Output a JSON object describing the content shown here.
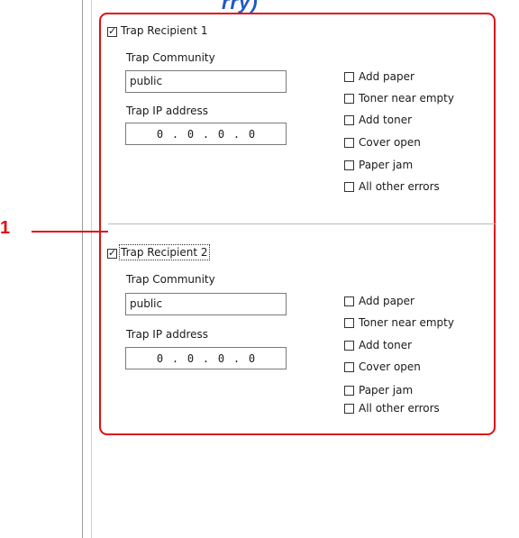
{
  "heading_fragment": "rry)",
  "callout_number": "1",
  "trap_recipients": [
    {
      "label": "Trap Recipient 1",
      "checked": true,
      "community_label": "Trap Community",
      "community_value": "public",
      "ip_label": "Trap IP address",
      "ip_octets": [
        "0",
        "0",
        "0",
        "0"
      ],
      "events": [
        {
          "label": "Add paper",
          "checked": false
        },
        {
          "label": "Toner near empty",
          "checked": false
        },
        {
          "label": "Add toner",
          "checked": false
        },
        {
          "label": "Cover open",
          "checked": false
        },
        {
          "label": "Paper jam",
          "checked": false
        },
        {
          "label": "All other errors",
          "checked": false
        }
      ]
    },
    {
      "label": "Trap Recipient 2",
      "checked": true,
      "community_label": "Trap Community",
      "community_value": "public",
      "ip_label": "Trap IP address",
      "ip_octets": [
        "0",
        "0",
        "0",
        "0"
      ],
      "events": [
        {
          "label": "Add paper",
          "checked": false
        },
        {
          "label": "Toner near empty",
          "checked": false
        },
        {
          "label": "Add toner",
          "checked": false
        },
        {
          "label": "Cover open",
          "checked": false
        },
        {
          "label": "Paper jam",
          "checked": false
        },
        {
          "label": "All other errors",
          "checked": false
        }
      ]
    }
  ],
  "colors": {
    "callout": "#e01010",
    "heading": "#1f57c8"
  }
}
